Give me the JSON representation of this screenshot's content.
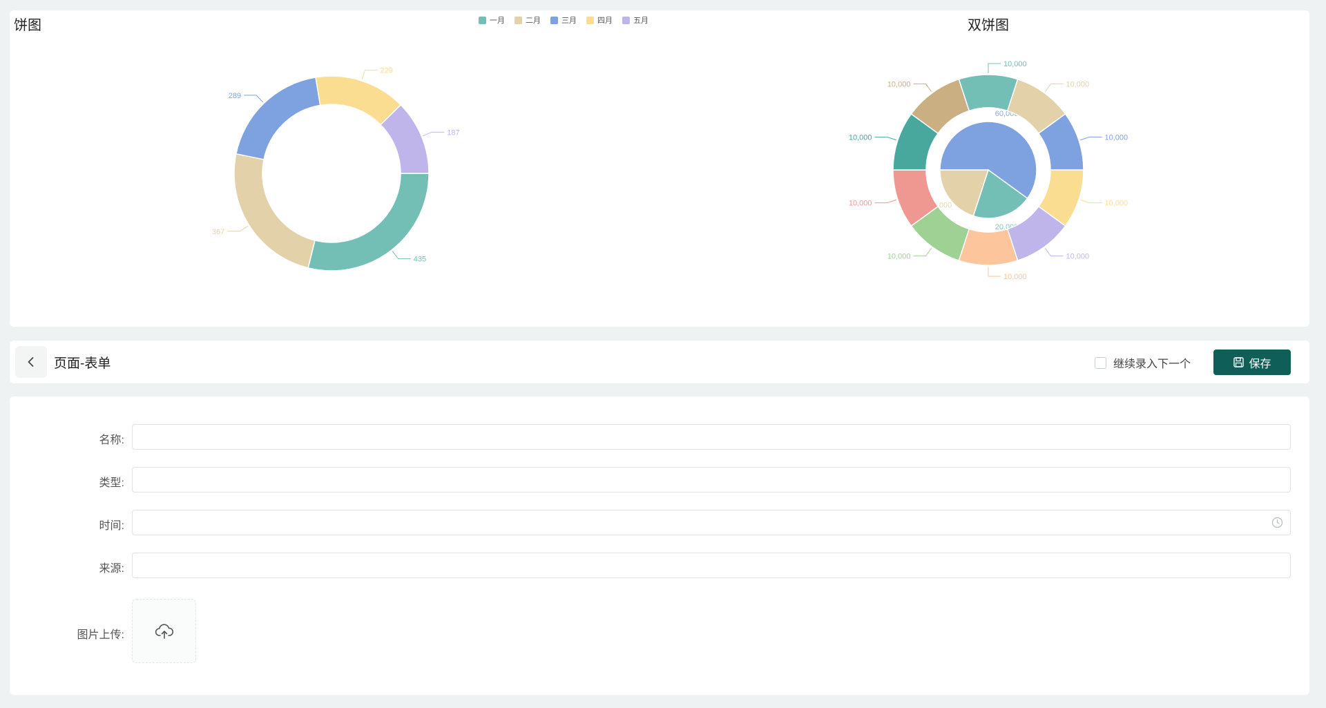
{
  "pie_chart": {
    "title": "饼图",
    "legend": [
      {
        "label": "一月",
        "color": "#73bfb6"
      },
      {
        "label": "二月",
        "color": "#e3d1aa"
      },
      {
        "label": "三月",
        "color": "#7ea1e0"
      },
      {
        "label": "四月",
        "color": "#fbdd91"
      },
      {
        "label": "五月",
        "color": "#c0b5ea"
      }
    ]
  },
  "double_pie_chart": {
    "title": "双饼图"
  },
  "chart_data": [
    {
      "type": "pie",
      "style": "donut",
      "categories": [
        "一月",
        "二月",
        "三月",
        "四月",
        "五月"
      ],
      "values": [
        435,
        367,
        289,
        229,
        187
      ],
      "labels": [
        "435",
        "367",
        "289",
        "229",
        "187"
      ],
      "colors": [
        "#73bfb6",
        "#e3d1aa",
        "#7ea1e0",
        "#fbdd91",
        "#c0b5ea"
      ],
      "legend_position": "top"
    },
    {
      "type": "pie",
      "style": "nested",
      "inner": {
        "values": [
          60000,
          20000,
          20000
        ],
        "labels": [
          "60,000",
          "20,000",
          "20,000"
        ],
        "colors": [
          "#7ea1e0",
          "#73bfb6",
          "#e3d1aa"
        ]
      },
      "outer": {
        "values": [
          10000,
          10000,
          10000,
          10000,
          10000,
          10000,
          10000,
          10000,
          10000,
          10000
        ],
        "labels": [
          "10,000",
          "10,000",
          "10,000",
          "10,000",
          "10,000",
          "10,000",
          "10,000",
          "10,000",
          "10,000",
          "10,000"
        ],
        "colors": [
          "#73bfb6",
          "#e3d1aa",
          "#7ea1e0",
          "#fbdd91",
          "#c0b5ea",
          "#fdc59c",
          "#9fd194",
          "#ef9791",
          "#48a89e",
          "#c9af82"
        ]
      }
    }
  ],
  "header": {
    "page_title": "页面-表单",
    "continue_label": "继续录入下一个",
    "save_label": "保存"
  },
  "form": {
    "fields": [
      {
        "label": "名称:",
        "value": ""
      },
      {
        "label": "类型:",
        "value": ""
      },
      {
        "label": "时间:",
        "value": ""
      },
      {
        "label": "来源:",
        "value": ""
      }
    ],
    "upload_label": "图片上传:"
  },
  "icons": {
    "back": "chevron-left-icon",
    "save": "floppy-disk-icon",
    "time": "clock-icon",
    "upload": "cloud-upload-icon"
  }
}
